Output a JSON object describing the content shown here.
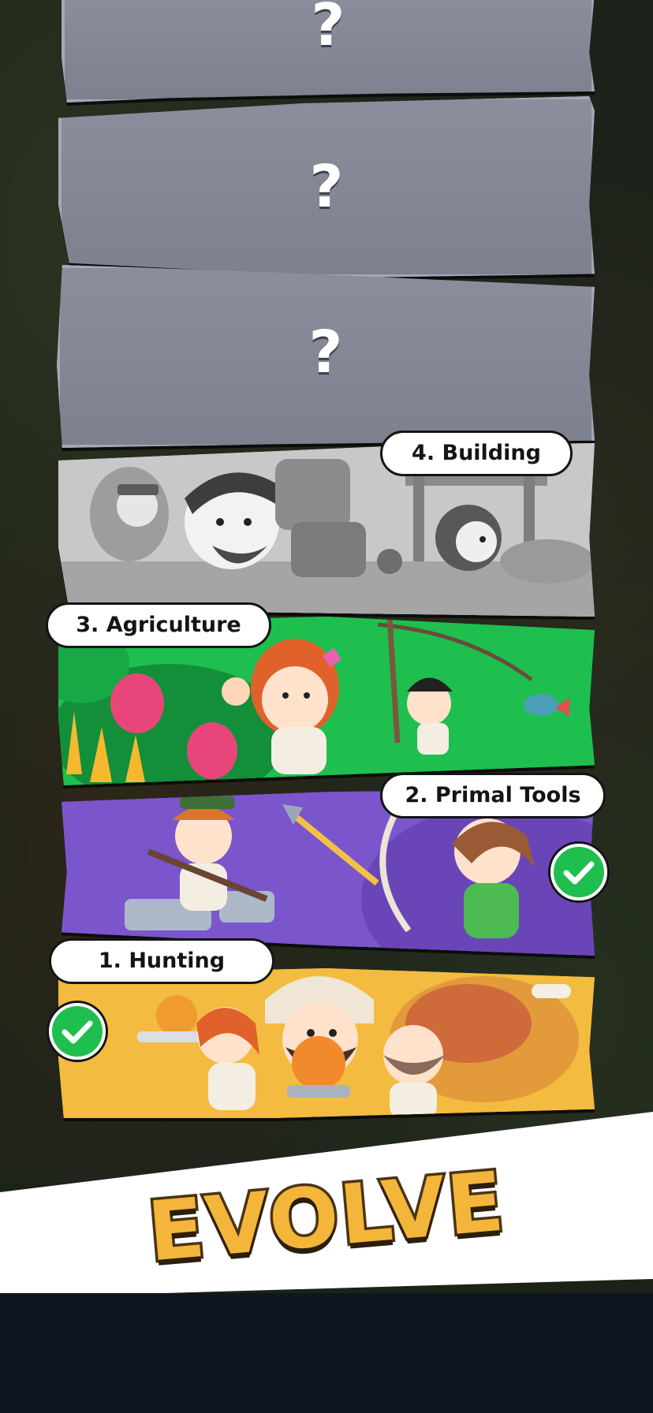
{
  "locked_era": {
    "symbol": "?"
  },
  "eras": [
    {
      "label": "4. Building",
      "completed": false
    },
    {
      "label": "3. Agriculture",
      "completed": false
    },
    {
      "label": "2. Primal Tools",
      "completed": true
    },
    {
      "label": "1. Hunting",
      "completed": true
    }
  ],
  "banner": {
    "title": "EVOLVE"
  },
  "colors": {
    "locked_slab": "#8b8e9c",
    "agriculture": "#19c04a",
    "primal_tools": "#7a52c9",
    "hunting": "#f1b93c",
    "check_badge": "#1fbf4f",
    "title_fill": "#f4b63a",
    "title_outline": "#4a3415"
  },
  "icons": {
    "completed": "checkmark-icon"
  }
}
